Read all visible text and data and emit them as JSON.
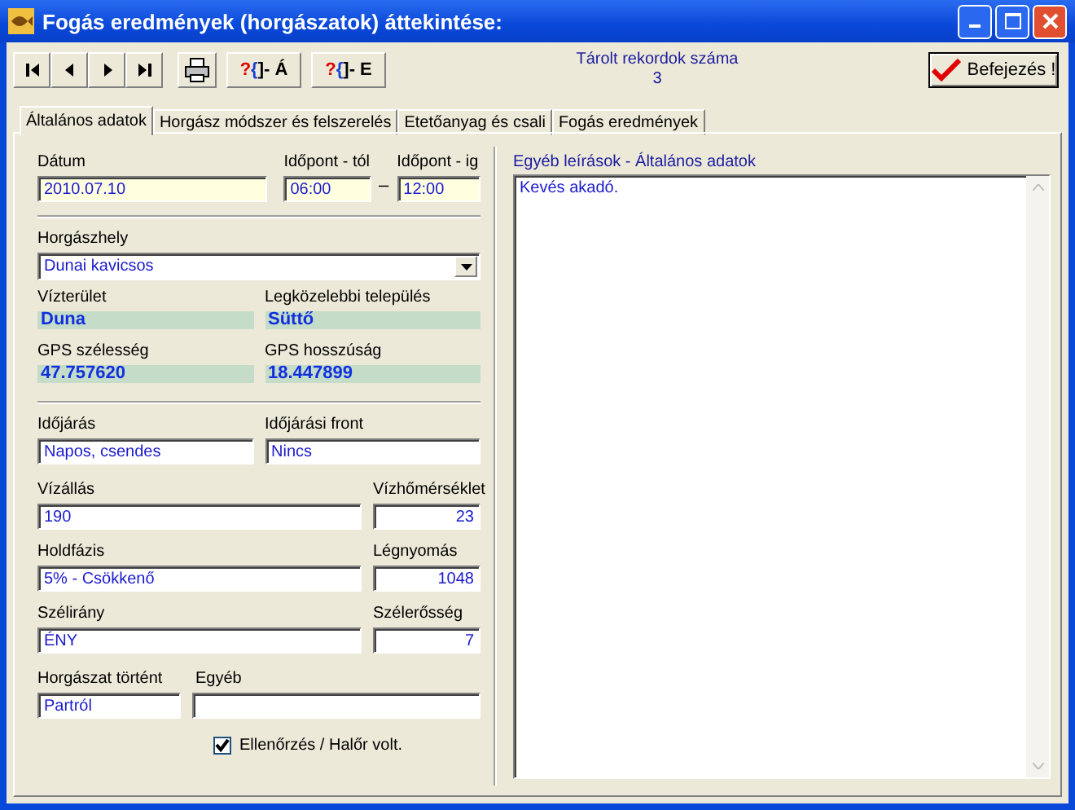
{
  "window": {
    "title": "Fogás eredmények (horgászatok) áttekintése:"
  },
  "toolbar": {
    "nav_buttons": [
      {
        "kind": "first"
      },
      {
        "kind": "prev"
      },
      {
        "kind": "next"
      },
      {
        "kind": "last"
      }
    ],
    "report_buttons": [
      {
        "glyphs": "?{]",
        "label": "- Á"
      },
      {
        "glyphs": "?{]",
        "label": "- E"
      }
    ],
    "record_count_label": "Tárolt rekordok száma",
    "record_count": "3",
    "finish_button": "Befejezés !"
  },
  "tabs": [
    {
      "label": "Általános adatok",
      "selected": true
    },
    {
      "label": "Horgász módszer és felszerelés",
      "selected": false
    },
    {
      "label": "Etetőanyag és csali",
      "selected": false
    },
    {
      "label": "Fogás eredmények",
      "selected": false
    }
  ],
  "rows": [
    {
      "kind": "datetime",
      "fields": [
        {
          "label": "Dátum",
          "value": "2010.07.10",
          "kind": "entry"
        },
        {
          "label": "Időpont - tól",
          "value": "06:00",
          "kind": "entry"
        },
        {
          "label": "Időpont - ig",
          "value": "12:00",
          "kind": "entry"
        }
      ],
      "separator": "–"
    },
    {
      "kind": "divider"
    },
    {
      "kind": "full",
      "fields": [
        {
          "label": "Horgászhely",
          "value": "Dunai kavicsos",
          "kind": "combo"
        }
      ]
    },
    {
      "kind": "halves",
      "fields": [
        {
          "label": "Vízterület",
          "value": "Duna",
          "kind": "info"
        },
        {
          "label": "Legközelebbi település",
          "value": "Süttő",
          "kind": "info"
        }
      ]
    },
    {
      "kind": "halves",
      "fields": [
        {
          "label": "GPS szélesség",
          "value": "47.757620",
          "kind": "info"
        },
        {
          "label": "GPS hosszúság",
          "value": "18.447899",
          "kind": "info"
        }
      ]
    },
    {
      "kind": "divider"
    },
    {
      "kind": "halves",
      "fields": [
        {
          "label": "Időjárás",
          "value": "Napos, csendes",
          "kind": "text"
        },
        {
          "label": "Időjárási front",
          "value": "Nincs",
          "kind": "text"
        }
      ]
    },
    {
      "kind": "wide-narrow",
      "fields": [
        {
          "label": "Vízállás",
          "value": "190",
          "kind": "text"
        },
        {
          "label": "Vízhőmérséklet",
          "value": "23",
          "kind": "number"
        }
      ]
    },
    {
      "kind": "wide-narrow",
      "fields": [
        {
          "label": "Holdfázis",
          "value": "5% - Csökkenő",
          "kind": "text"
        },
        {
          "label": "Légnyomás",
          "value": "1048",
          "kind": "number"
        }
      ]
    },
    {
      "kind": "wide-narrow",
      "fields": [
        {
          "label": "Szélirány",
          "value": "ÉNY",
          "kind": "text"
        },
        {
          "label": "Szélerősség",
          "value": "7",
          "kind": "number"
        }
      ]
    },
    {
      "kind": "short-long",
      "fields": [
        {
          "label": "Horgászat történt",
          "value": "Partról",
          "kind": "text"
        },
        {
          "label": "Egyéb",
          "kind": "text"
        }
      ]
    }
  ],
  "checkbox": {
    "label": "Ellenőrzés / Halőr volt.",
    "checked": true
  },
  "notes": {
    "label": "Egyéb leírások - Általános adatok",
    "value": "Kevés akadó."
  }
}
